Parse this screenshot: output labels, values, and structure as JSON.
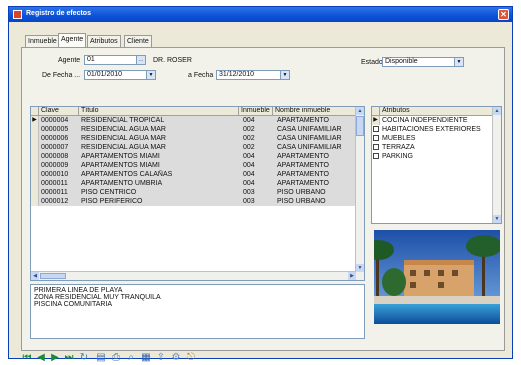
{
  "window": {
    "title": "Registro de efectos",
    "close_glyph": "✕"
  },
  "tabs": [
    {
      "label": "Inmueble"
    },
    {
      "label": "Agente"
    },
    {
      "label": "Atributos"
    },
    {
      "label": "Cliente"
    }
  ],
  "filters": {
    "agente_label": "Agente",
    "agente_value": "01",
    "agente_name": "DR. ROSER",
    "desde_label": "De Fecha ...",
    "desde_value": "01/01/2010",
    "hasta_label": "a Fecha",
    "hasta_value": "31/12/2010",
    "estado_label": "Estado",
    "estado_value": "Disponible"
  },
  "main_table": {
    "columns": [
      "Clave",
      "Título",
      "Inmueble",
      "Nombre inmueble"
    ],
    "rows": [
      [
        "0000004",
        "RESIDENCIAL TROPICAL",
        "004",
        "APARTAMENTO"
      ],
      [
        "0000005",
        "RESIDENCIAL AGUA MAR",
        "002",
        "CASA UNIFAMILIAR"
      ],
      [
        "0000006",
        "RESIDENCIAL AGUA MAR",
        "002",
        "CASA UNIFAMILIAR"
      ],
      [
        "0000007",
        "RESIDENCIAL AGUA MAR",
        "002",
        "CASA UNIFAMILIAR"
      ],
      [
        "0000008",
        "APARTAMENTOS MIAMI",
        "004",
        "APARTAMENTO"
      ],
      [
        "0000009",
        "APARTAMENTOS MIAMI",
        "004",
        "APARTAMENTO"
      ],
      [
        "0000010",
        "APARTAMENTOS CALAÑAS",
        "004",
        "APARTAMENTO"
      ],
      [
        "0000011",
        "APARTAMENTO UMBRIA",
        "004",
        "APARTAMENTO"
      ],
      [
        "0000011",
        "PISO CENTRICO",
        "003",
        "PISO URBANO"
      ],
      [
        "0000012",
        "PISO PERIFERICO",
        "003",
        "PISO URBANO"
      ]
    ]
  },
  "attributes": {
    "header": "Atributos",
    "items": [
      "COCINA INDEPENDIENTE",
      "HABITACIONES EXTERIORES",
      "MUEBLES",
      "TERRAZA",
      "PARKING"
    ]
  },
  "notes": {
    "lines": [
      "PRIMERA LINEA DE PLAYA",
      "ZONA RESIDENCIAL MUY TRANQUILA",
      "PISCINA COMUNITARIA"
    ]
  },
  "toolbar": {
    "icons": [
      "first-record-icon",
      "prev-record-icon",
      "next-record-icon",
      "last-record-icon",
      "refresh-icon",
      "print-preview-icon",
      "print-icon",
      "search-icon",
      "chart-icon",
      "export-icon",
      "settings-icon",
      "exit-icon"
    ]
  },
  "colors": {
    "titlebar": "#0b52d9",
    "selected_row": "#dcdcdc",
    "accent_toolbar": "#1a8a3a"
  }
}
